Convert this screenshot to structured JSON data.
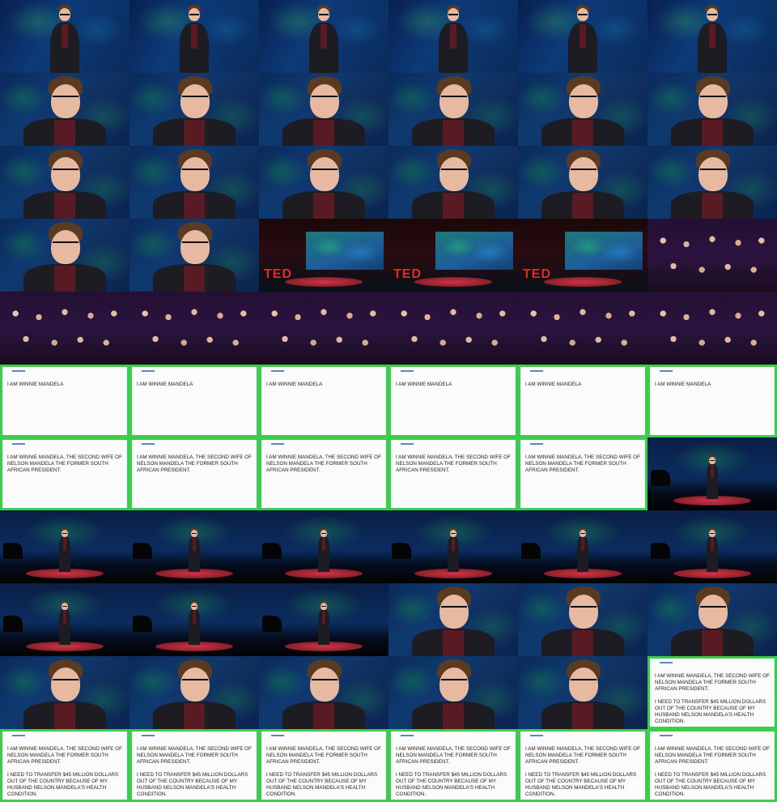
{
  "layout": "contact-sheet",
  "rows": 11,
  "cols": 6,
  "branding": {
    "logo_text": "TED",
    "logo_color": "#e62b1e"
  },
  "slide": {
    "border_color": "#3ccd4a",
    "line1": "I AM WINNIE MANDELA",
    "line2": "I AM WINNIE MANDELA, THE SECOND WIFE OF NELSON MANDELA THE FORMER SOUTH AFRICAN PRESIDENT.",
    "line3": "I AM WINNIE MANDELA, THE SECOND WIFE OF NELSON MANDELA THE FORMER SOUTH AFRICAN PRESIDENT.\n\nI NEED TO TRANSFER $45 MILLION DOLLARS OUT OF THE COUNTRY BECAUSE OF MY HUSBAND NELSON MANDELA'S HEALTH CONDITION."
  },
  "frames": [
    "speaker-medium",
    "speaker-medium",
    "speaker-medium",
    "speaker-medium",
    "speaker-medium",
    "speaker-medium",
    "speaker-close",
    "speaker-close",
    "speaker-close",
    "speaker-close",
    "speaker-close",
    "speaker-close",
    "speaker-close",
    "speaker-close",
    "speaker-close",
    "speaker-close",
    "speaker-close",
    "speaker-close",
    "speaker-close",
    "speaker-close",
    "venue-wide",
    "venue-wide",
    "venue-wide",
    "audience",
    "audience",
    "audience",
    "audience",
    "audience",
    "audience",
    "audience",
    "slide-1",
    "slide-1",
    "slide-1",
    "slide-1",
    "slide-1",
    "slide-1",
    "slide-2",
    "slide-2",
    "slide-2",
    "slide-2",
    "slide-2",
    "stage-wide",
    "stage-wide",
    "stage-wide",
    "stage-wide",
    "stage-wide",
    "stage-wide",
    "stage-wide",
    "stage-wide",
    "stage-wide",
    "stage-wide",
    "speaker-close",
    "speaker-close",
    "speaker-close",
    "speaker-close",
    "speaker-close",
    "speaker-close",
    "speaker-close",
    "speaker-close",
    "slide-3",
    "slide-3",
    "slide-3",
    "slide-3",
    "slide-3",
    "slide-3",
    "slide-3"
  ]
}
